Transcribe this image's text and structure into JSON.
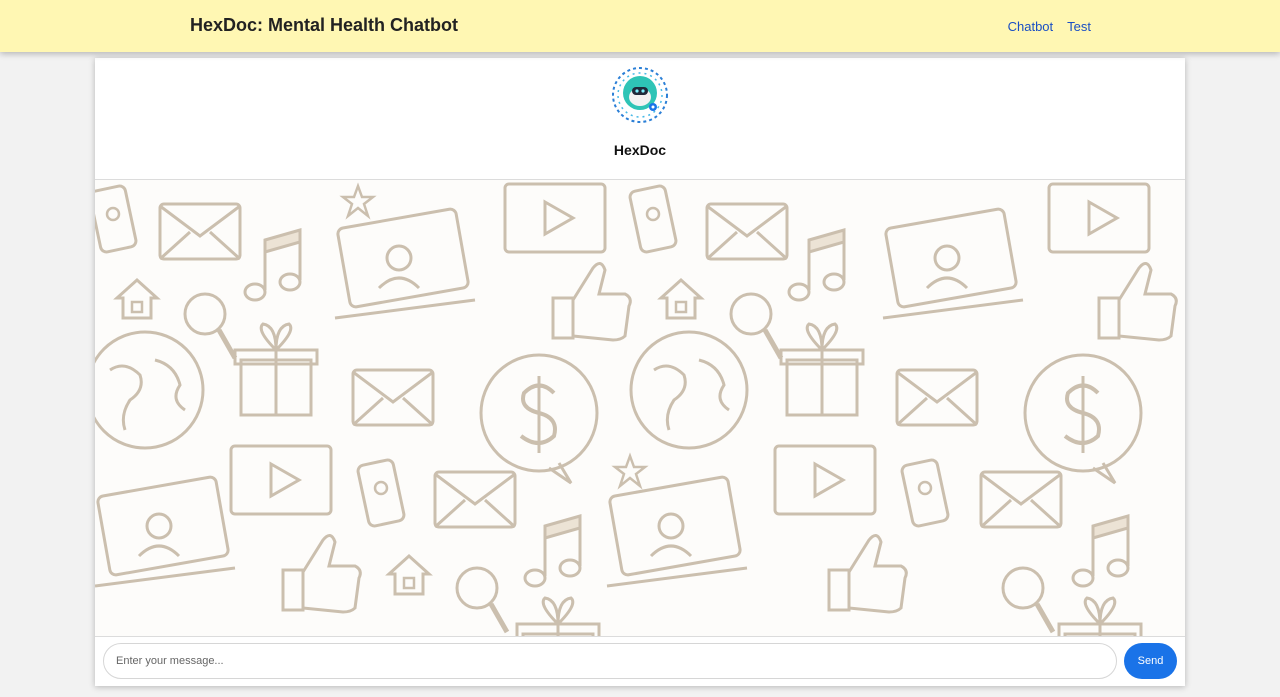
{
  "header": {
    "title": "HexDoc: Mental Health Chatbot",
    "nav": [
      {
        "label": "Chatbot"
      },
      {
        "label": "Test"
      }
    ]
  },
  "chat": {
    "bot_name": "HexDoc",
    "avatar_icon": "robot-avatar-icon",
    "background_pattern": "doodle-icons-pattern"
  },
  "composer": {
    "placeholder": "Enter your message...",
    "value": "",
    "send_label": "Send"
  },
  "colors": {
    "topbar": "#fff7b3",
    "accent": "#1a73e8",
    "link": "#1a4fc4",
    "doodle": "#cbbfae"
  }
}
